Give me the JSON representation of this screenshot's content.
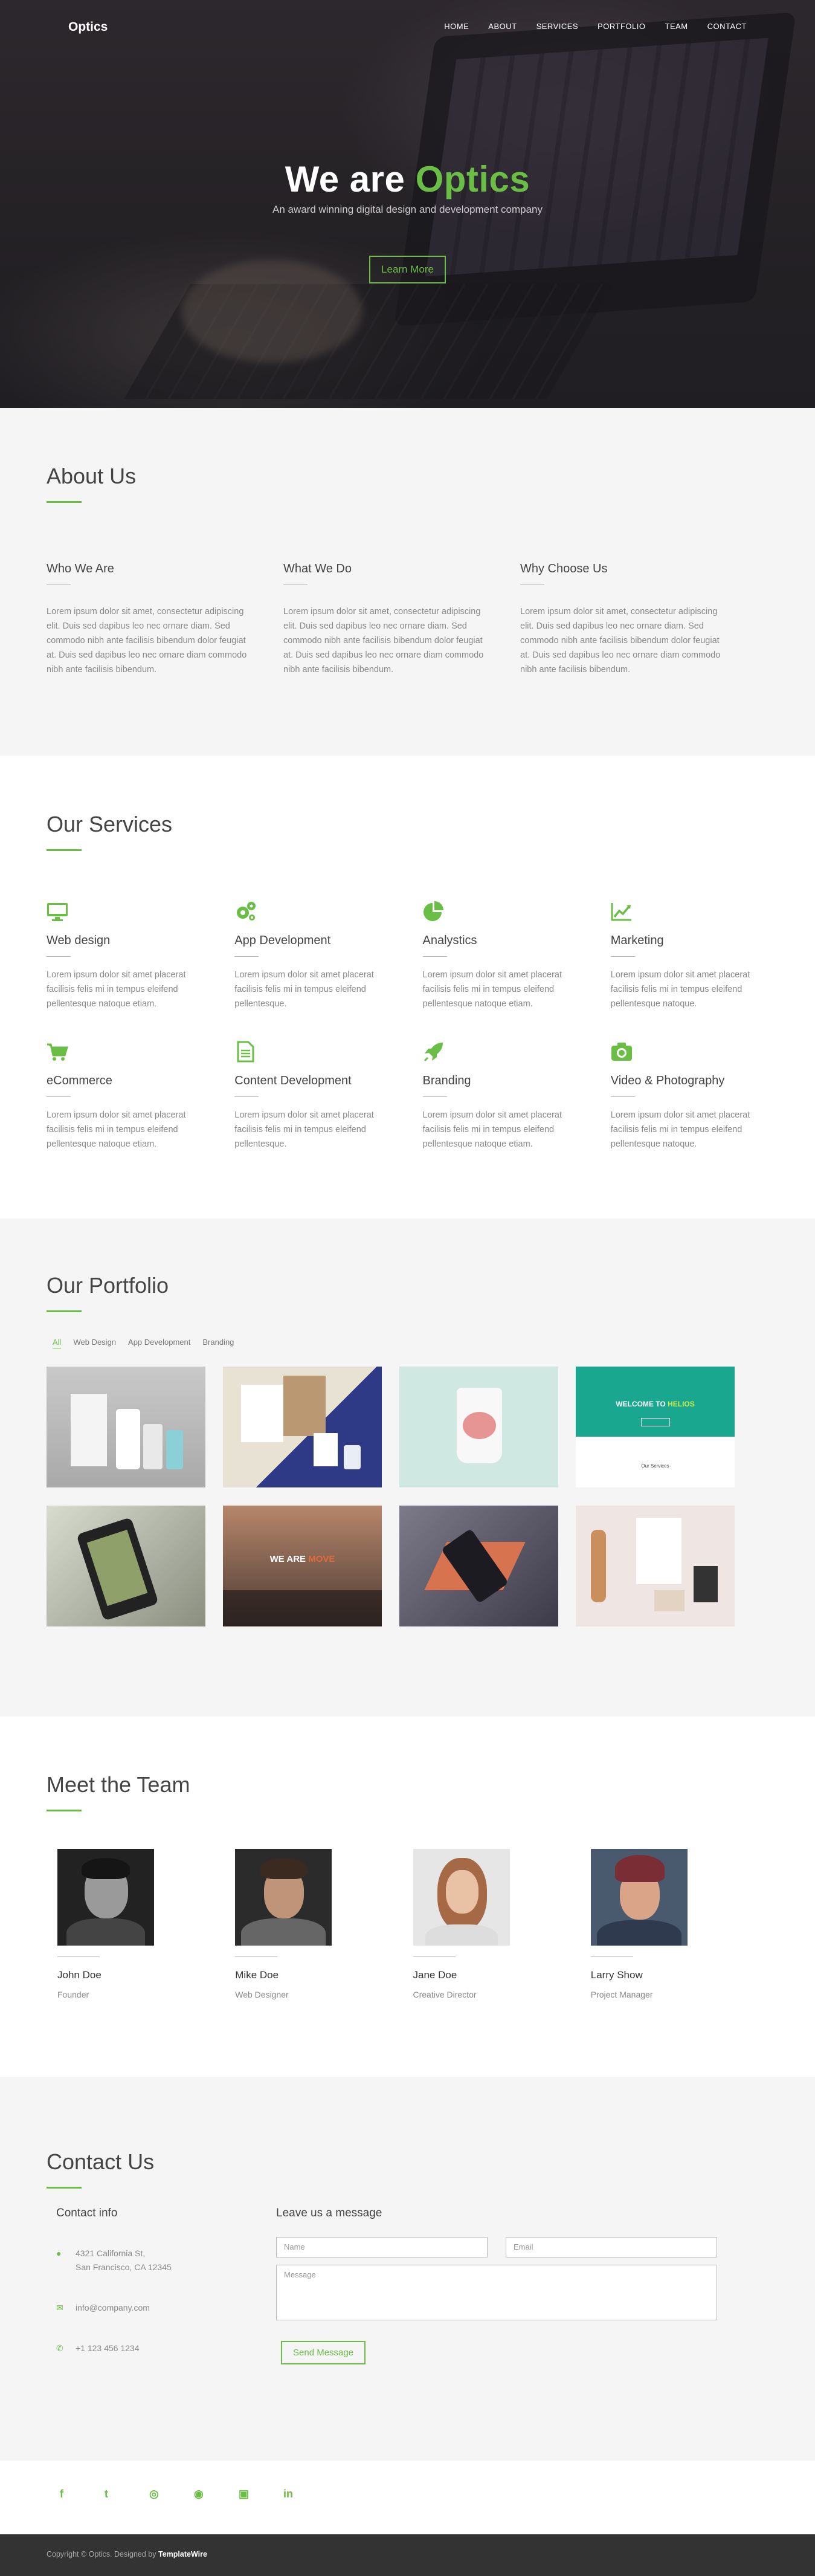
{
  "brand": "Optics",
  "nav": [
    "HOME",
    "ABOUT",
    "SERVICES",
    "PORTFOLIO",
    "TEAM",
    "CONTACT"
  ],
  "hero": {
    "title_prefix": "We are",
    "title_accent": "Optics",
    "subtitle": "An award winning digital design and development company",
    "button": "Learn More"
  },
  "colors": {
    "accent": "#6abd45",
    "dark": "#333333",
    "light_bg": "#f5f5f5"
  },
  "about": {
    "title": "About Us",
    "columns": [
      {
        "heading": "Who We Are",
        "text": "Lorem ipsum dolor sit amet, consectetur adipiscing elit. Duis sed dapibus leo nec ornare diam. Sed commodo nibh ante facilisis bibendum dolor feugiat at. Duis sed dapibus leo nec ornare diam commodo nibh ante facilisis bibendum."
      },
      {
        "heading": "What We Do",
        "text": "Lorem ipsum dolor sit amet, consectetur adipiscing elit. Duis sed dapibus leo nec ornare diam. Sed commodo nibh ante facilisis bibendum dolor feugiat at. Duis sed dapibus leo nec ornare diam commodo nibh ante facilisis bibendum."
      },
      {
        "heading": "Why Choose Us",
        "text": "Lorem ipsum dolor sit amet, consectetur adipiscing elit. Duis sed dapibus leo nec ornare diam. Sed commodo nibh ante facilisis bibendum dolor feugiat at. Duis sed dapibus leo nec ornare diam commodo nibh ante facilisis bibendum."
      }
    ]
  },
  "services": {
    "title": "Our Services",
    "items": [
      {
        "icon": "desktop-icon",
        "name": "Web design",
        "text": "Lorem ipsum dolor sit amet placerat facilisis felis mi in tempus eleifend pellentesque natoque etiam."
      },
      {
        "icon": "gears-icon",
        "name": "App Development",
        "text": "Lorem ipsum dolor sit amet placerat facilisis felis mi in tempus eleifend pellentesque."
      },
      {
        "icon": "pie-chart-icon",
        "name": "Analystics",
        "text": "Lorem ipsum dolor sit amet placerat facilisis felis mi in tempus eleifend pellentesque natoque etiam."
      },
      {
        "icon": "line-chart-icon",
        "name": "Marketing",
        "text": "Lorem ipsum dolor sit amet placerat facilisis felis mi in tempus eleifend pellentesque natoque."
      },
      {
        "icon": "cart-icon",
        "name": "eCommerce",
        "text": "Lorem ipsum dolor sit amet placerat facilisis felis mi in tempus eleifend pellentesque natoque etiam."
      },
      {
        "icon": "document-icon",
        "name": "Content Development",
        "text": "Lorem ipsum dolor sit amet placerat facilisis felis mi in tempus eleifend pellentesque."
      },
      {
        "icon": "rocket-icon",
        "name": "Branding",
        "text": "Lorem ipsum dolor sit amet placerat facilisis felis mi in tempus eleifend pellentesque natoque etiam."
      },
      {
        "icon": "camera-icon",
        "name": "Video & Photography",
        "text": "Lorem ipsum dolor sit amet placerat facilisis felis mi in tempus eleifend pellentesque natoque."
      }
    ]
  },
  "portfolio": {
    "title": "Our Portfolio",
    "filters": [
      "All",
      "Web Design",
      "App Development",
      "Branding"
    ],
    "thumb4_heading_prefix": "WELCOME TO",
    "thumb4_heading_accent": "HELIOS",
    "thumb4_caption": "Our Services",
    "thumb6_heading_prefix": "WE ARE",
    "thumb6_heading_accent": "MOVE"
  },
  "team": {
    "title": "Meet the Team",
    "members": [
      {
        "name": "John Doe",
        "role": "Founder"
      },
      {
        "name": "Mike Doe",
        "role": "Web Designer"
      },
      {
        "name": "Jane Doe",
        "role": "Creative Director"
      },
      {
        "name": "Larry Show",
        "role": "Project Manager"
      }
    ]
  },
  "contact": {
    "title": "Contact Us",
    "info_title": "Contact info",
    "address_line1": "4321 California St,",
    "address_line2": "San Francisco, CA 12345",
    "email": "info@company.com",
    "phone": "+1 123 456 1234",
    "form_title": "Leave us a message",
    "name_placeholder": "Name",
    "email_placeholder": "Email",
    "message_placeholder": "Message",
    "send": "Send Message"
  },
  "social_icons": [
    "facebook-icon",
    "twitter-icon",
    "dribbble-icon",
    "github-icon",
    "instagram-icon",
    "linkedin-icon"
  ],
  "footer": {
    "copyright": "Copyright © Optics. Designed by",
    "designer": "TemplateWire"
  }
}
